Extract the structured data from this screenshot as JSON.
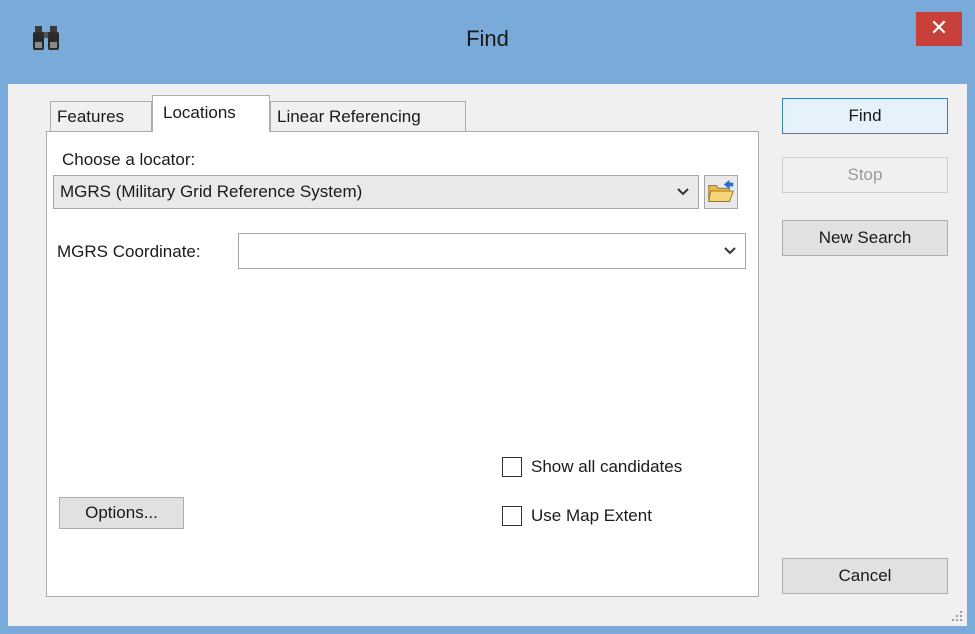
{
  "window": {
    "title": "Find",
    "icon": "binoculars-icon",
    "close_label": "✕"
  },
  "tabs": [
    {
      "label": "Features",
      "active": false
    },
    {
      "label": "Locations",
      "active": true
    },
    {
      "label": "Linear Referencing",
      "active": false
    }
  ],
  "locations": {
    "locator_label": "Choose a locator:",
    "locator_value": "MGRS (Military Grid Reference System)",
    "coordinate_label": "MGRS Coordinate:",
    "coordinate_value": "",
    "show_all_candidates_label": "Show all candidates",
    "show_all_candidates_checked": false,
    "use_map_extent_label": "Use Map Extent",
    "use_map_extent_checked": false,
    "options_label": "Options..."
  },
  "buttons": {
    "find": "Find",
    "stop": "Stop",
    "new_search": "New Search",
    "cancel": "Cancel"
  },
  "colors": {
    "title_bar": "#7aaad9",
    "close_button": "#c7413a",
    "dialog_background": "#f0f0f0"
  }
}
